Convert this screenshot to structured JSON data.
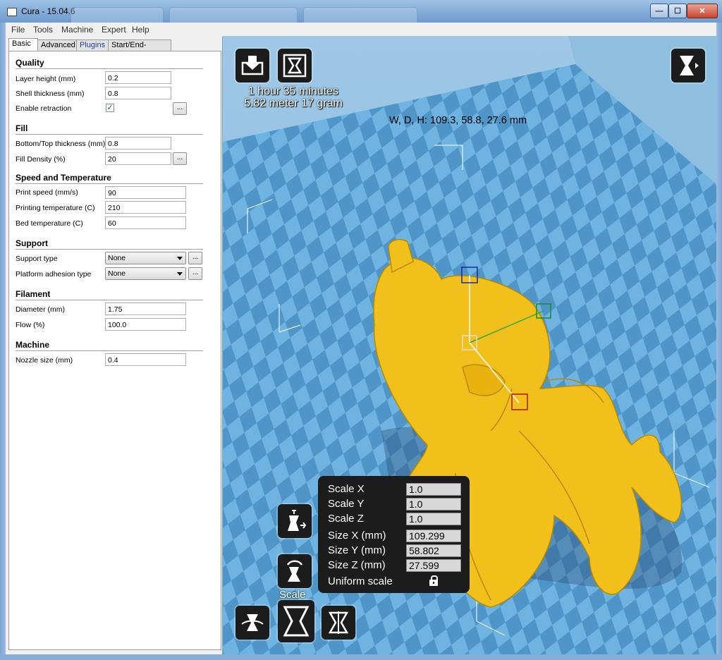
{
  "window": {
    "title": "Cura - 15.04.6",
    "controls": {
      "minimize": "—",
      "maximize": "☐",
      "close": "✕"
    }
  },
  "menu": [
    "File",
    "Tools",
    "Machine",
    "Expert",
    "Help"
  ],
  "tabs": [
    "Basic",
    "Advanced",
    "Plugins",
    "Start/End-GCode"
  ],
  "sections": {
    "quality": "Quality",
    "fill": "Fill",
    "speed": "Speed and Temperature",
    "support": "Support",
    "filament": "Filament",
    "machine": "Machine"
  },
  "settings": {
    "layer_height": {
      "label": "Layer height (mm)",
      "value": "0.2"
    },
    "shell_thickness": {
      "label": "Shell thickness (mm)",
      "value": "0.8"
    },
    "enable_retraction": {
      "label": "Enable retraction",
      "checked": "✓"
    },
    "bottom_top_thickness": {
      "label": "Bottom/Top thickness (mm)",
      "value": "0.8"
    },
    "fill_density": {
      "label": "Fill Density (%)",
      "value": "20"
    },
    "print_speed": {
      "label": "Print speed (mm/s)",
      "value": "90"
    },
    "printing_temperature": {
      "label": "Printing temperature (C)",
      "value": "210"
    },
    "bed_temperature": {
      "label": "Bed temperature (C)",
      "value": "60"
    },
    "support_type": {
      "label": "Support type",
      "value": "None"
    },
    "platform_adhesion": {
      "label": "Platform adhesion type",
      "value": "None"
    },
    "diameter": {
      "label": "Diameter (mm)",
      "value": "1.75"
    },
    "flow": {
      "label": "Flow (%)",
      "value": "100.0"
    },
    "nozzle_size": {
      "label": "Nozzle size (mm)",
      "value": "0.4"
    },
    "more_button": "..."
  },
  "viewport": {
    "print_time": "1 hour 35 minutes",
    "print_material": "5.82 meter 17 gram",
    "dimensions": "W, D, H: 109.3, 58.8, 27.6 mm",
    "scale_tool_label": "Scale"
  },
  "scale_panel": {
    "scale_x": {
      "label": "Scale X",
      "value": "1.0"
    },
    "scale_y": {
      "label": "Scale Y",
      "value": "1.0"
    },
    "scale_z": {
      "label": "Scale Z",
      "value": "1.0"
    },
    "size_x": {
      "label": "Size X (mm)",
      "value": "109.299"
    },
    "size_y": {
      "label": "Size Y (mm)",
      "value": "58.802"
    },
    "size_z": {
      "label": "Size Z (mm)",
      "value": "27.599"
    },
    "uniform_scale": "Uniform scale"
  },
  "colors": {
    "model": "#f2c01a",
    "bed_light": "#6fb3e0",
    "bed_dark": "#4f95c8",
    "tool_bg": "#1c1c1c"
  }
}
